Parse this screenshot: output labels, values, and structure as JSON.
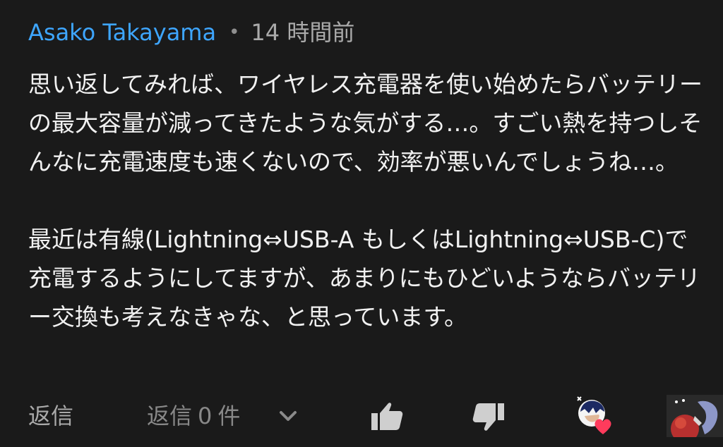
{
  "comment": {
    "author": "Asako Takayama",
    "separator": "•",
    "time": "14 時間前",
    "paragraphs": [
      "思い返してみれば、ワイヤレス充電器を使い始めたらバッテリーの最大容量が減ってきたような気がする…。すごい熱を持つしそんなに充電速度も速くないので、効率が悪いんでしょうね…。",
      "最近は有線(Lightning⇔USB-A もしくはLightning⇔USB-C)で充電するようにしてますが、あまりにもひどいようならバッテリー交換も考えなきゃな、と思っています。"
    ]
  },
  "actions": {
    "reply_label": "返信",
    "replies_label": "返信",
    "replies_count": "0",
    "replies_unit": "件",
    "icons": {
      "expand": "chevron-down-icon",
      "like": "thumbs-up-icon",
      "dislike": "thumbs-down-icon",
      "creator_heart": "creator-heart-icon",
      "avatar": "avatar-icon"
    }
  },
  "colors": {
    "background": "#1a1a1a",
    "author": "#3ea6ff",
    "text": "#f1f1f1",
    "muted": "#aaaaaa",
    "heart": "#ff3b5c"
  }
}
